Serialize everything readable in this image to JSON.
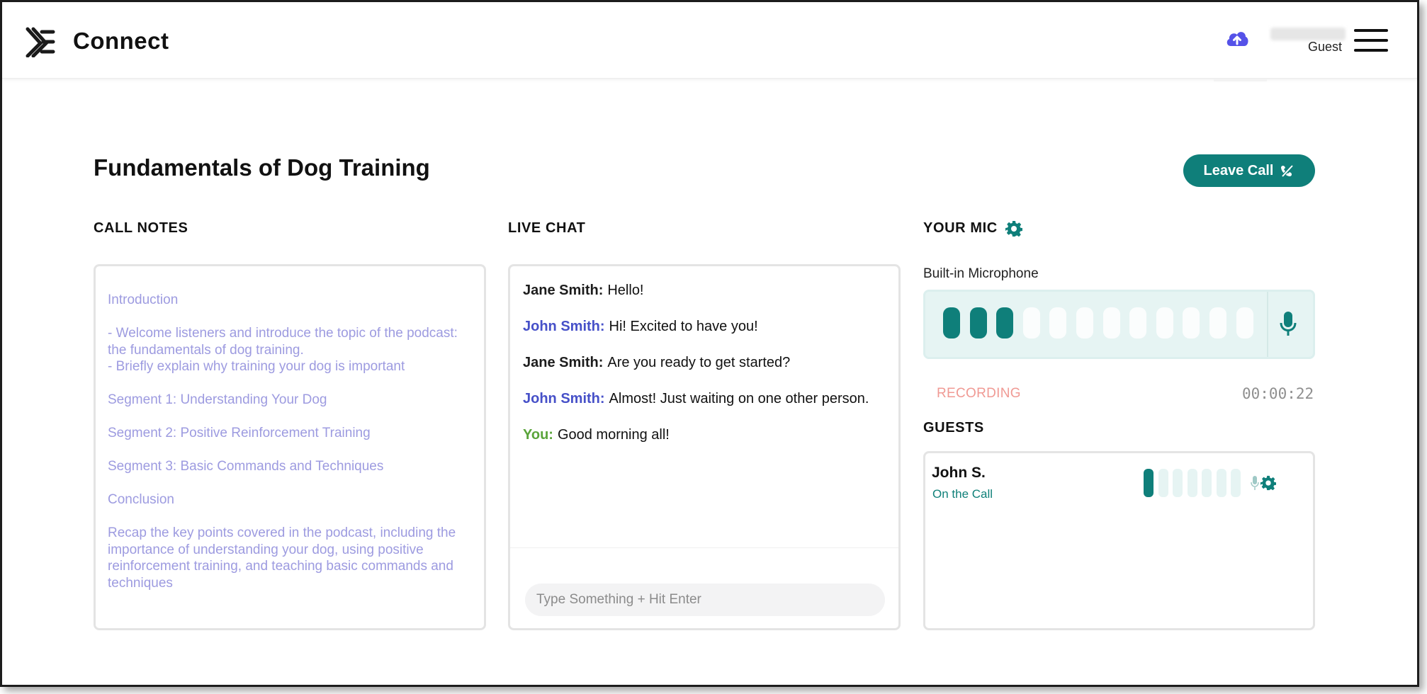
{
  "app": {
    "brand": "Connect",
    "user_role": "Guest",
    "colors": {
      "accent": "#0f7f7a",
      "upload": "#5552e8",
      "john": "#4650c8",
      "you": "#5aa43a",
      "notes": "#9d9be0",
      "recording": "#f09a94"
    },
    "icons": {
      "logo": "connect-logo-icon",
      "upload": "cloud-upload-icon",
      "menu": "hamburger-menu-icon"
    }
  },
  "page": {
    "title": "Fundamentals of Dog Training",
    "leave_label": "Leave Call",
    "leave_icon": "hang-up-icon"
  },
  "notes": {
    "heading": "CALL NOTES",
    "lines": [
      "Introduction",
      "- Welcome listeners and introduce the topic of the podcast: the fundamentals of dog training.",
      "- Briefly explain why training your dog is important",
      "Segment 1: Understanding Your Dog",
      "Segment 2: Positive Reinforcement Training",
      "Segment 3: Basic Commands and Techniques",
      "Conclusion",
      "Recap the key points covered in the podcast, including the importance of understanding your dog, using positive reinforcement training, and teaching basic commands and techniques"
    ]
  },
  "chat": {
    "heading": "LIVE CHAT",
    "messages": [
      {
        "author": "Jane Smith:",
        "text": "Hello!"
      },
      {
        "author": "John Smith:",
        "text": "Hi! Excited to have you!"
      },
      {
        "author": "Jane Smith:",
        "text": "Are you ready to get started?"
      },
      {
        "author": "John Smith:",
        "text": "Almost! Just waiting on one other person."
      },
      {
        "author": "You:",
        "text": "Good morning all!"
      }
    ],
    "input_placeholder": "Type Something + Hit Enter",
    "input_value": ""
  },
  "mic": {
    "heading": "YOUR MIC",
    "device": "Built-in Microphone",
    "level_bars_total": 12,
    "level_bars_active": 3,
    "status": "RECORDING",
    "elapsed": "00:00:22",
    "icons": {
      "settings": "gear-icon",
      "mic": "microphone-icon"
    }
  },
  "guests": {
    "heading": "GUESTS",
    "list": [
      {
        "name": "John S.",
        "status": "On the Call",
        "level_bars_total": 7,
        "level_bars_active": 1
      }
    ]
  }
}
